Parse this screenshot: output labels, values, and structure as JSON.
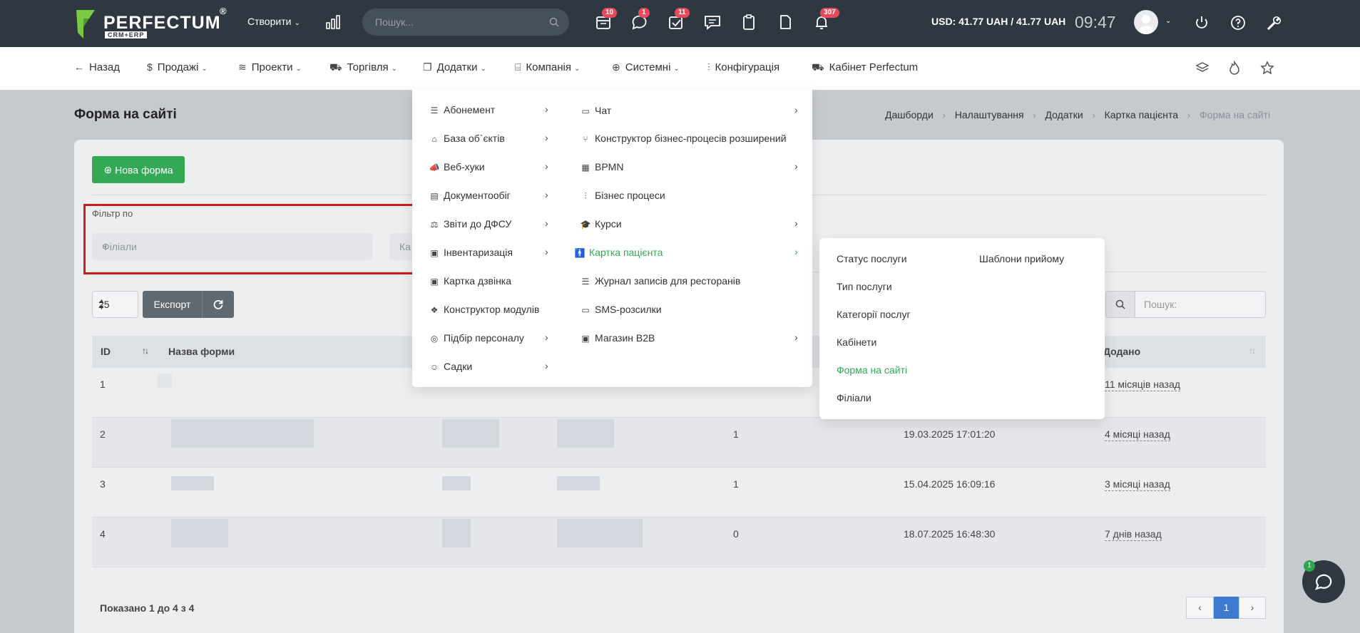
{
  "topbar": {
    "logo_text": "PERFECTUM",
    "logo_reg": "®",
    "logo_sub": "CRM+ERP",
    "create_label": "Створити",
    "search_placeholder": "Пошук...",
    "badges": {
      "calendar": "10",
      "chat": "1",
      "tasks": "11",
      "bell": "307"
    },
    "currency": "USD: 41.77 UAH / 41.77 UAH",
    "time": "09:47"
  },
  "nav": {
    "back": "Назад",
    "sales": "Продажі",
    "projects": "Проекти",
    "trade": "Торгівля",
    "addons": "Додатки",
    "company": "Компанія",
    "system": "Системні",
    "config": "Конфігурація",
    "cabinet": "Кабінет Perfectum"
  },
  "page": {
    "title": "Форма на сайті",
    "breadcrumb": [
      "Дашборди",
      "Налаштування",
      "Додатки",
      "Картка пацієнта",
      "Форма на сайті"
    ],
    "new_form": "Нова форма",
    "filter_label": "Фільтр по",
    "filter_placeholder": "Філіали",
    "filter2_placeholder": "Ка",
    "page_size": "25",
    "export": "Експорт",
    "search_placeholder": "Пошук:",
    "shown": "Показано 1 до 4 з 4",
    "pager_current": "1",
    "chat_badge": "1"
  },
  "table": {
    "headers": {
      "id": "ID",
      "name": "Назва форми",
      "added": "Додано"
    },
    "rows": [
      {
        "id": "1",
        "count": "",
        "date": "",
        "added": "11 місяців назад"
      },
      {
        "id": "2",
        "count": "1",
        "date": "19.03.2025 17:01:20",
        "added": "4 місяці назад"
      },
      {
        "id": "3",
        "count": "1",
        "date": "15.04.2025 16:09:16",
        "added": "3 місяці назад"
      },
      {
        "id": "4",
        "count": "0",
        "date": "18.07.2025 16:48:30",
        "added": "7 днів назад"
      }
    ]
  },
  "menu": {
    "left": [
      {
        "label": "Абонемент",
        "icon": "list-icon"
      },
      {
        "label": "База об`єктів",
        "icon": "home-icon"
      },
      {
        "label": "Веб-хуки",
        "icon": "megaphone-icon"
      },
      {
        "label": "Документообіг",
        "icon": "books-icon"
      },
      {
        "label": "Звіти до ДФСУ",
        "icon": "scales-icon"
      },
      {
        "label": "Інвентаризація",
        "icon": "clipboard-icon"
      },
      {
        "label": "Картка дзвінка",
        "icon": "clipboard-icon"
      },
      {
        "label": "Конструктор модулів",
        "icon": "cubes-icon"
      },
      {
        "label": "Підбір персоналу",
        "icon": "target-icon"
      },
      {
        "label": "Садки",
        "icon": "smile-icon"
      }
    ],
    "right": [
      {
        "label": "Чат",
        "icon": "chat-icon"
      },
      {
        "label": "Конструктор бізнес-процесів розширений",
        "icon": "branch-icon"
      },
      {
        "label": "BPMN",
        "icon": "layout-icon"
      },
      {
        "label": "Бізнес процеси",
        "icon": "sliders-icon"
      },
      {
        "label": "Курси",
        "icon": "graduation-icon"
      },
      {
        "label": "Картка пацієнта",
        "icon": "person-icon"
      },
      {
        "label": "Журнал записів для ресторанів",
        "icon": "list-icon"
      },
      {
        "label": "SMS-розсилки",
        "icon": "message-icon"
      },
      {
        "label": "Магазин B2B",
        "icon": "shop-icon"
      }
    ],
    "sub": [
      "Статус послуги",
      "Тип послуги",
      "Категорії послуг",
      "Кабінети",
      "Форма на сайті",
      "Філіали",
      "Шаблони прийому"
    ]
  },
  "colors": {
    "accent": "#33a956",
    "highlight": "#d11a1a",
    "topbar": "#2f3740",
    "badge": "#e54b5b"
  }
}
